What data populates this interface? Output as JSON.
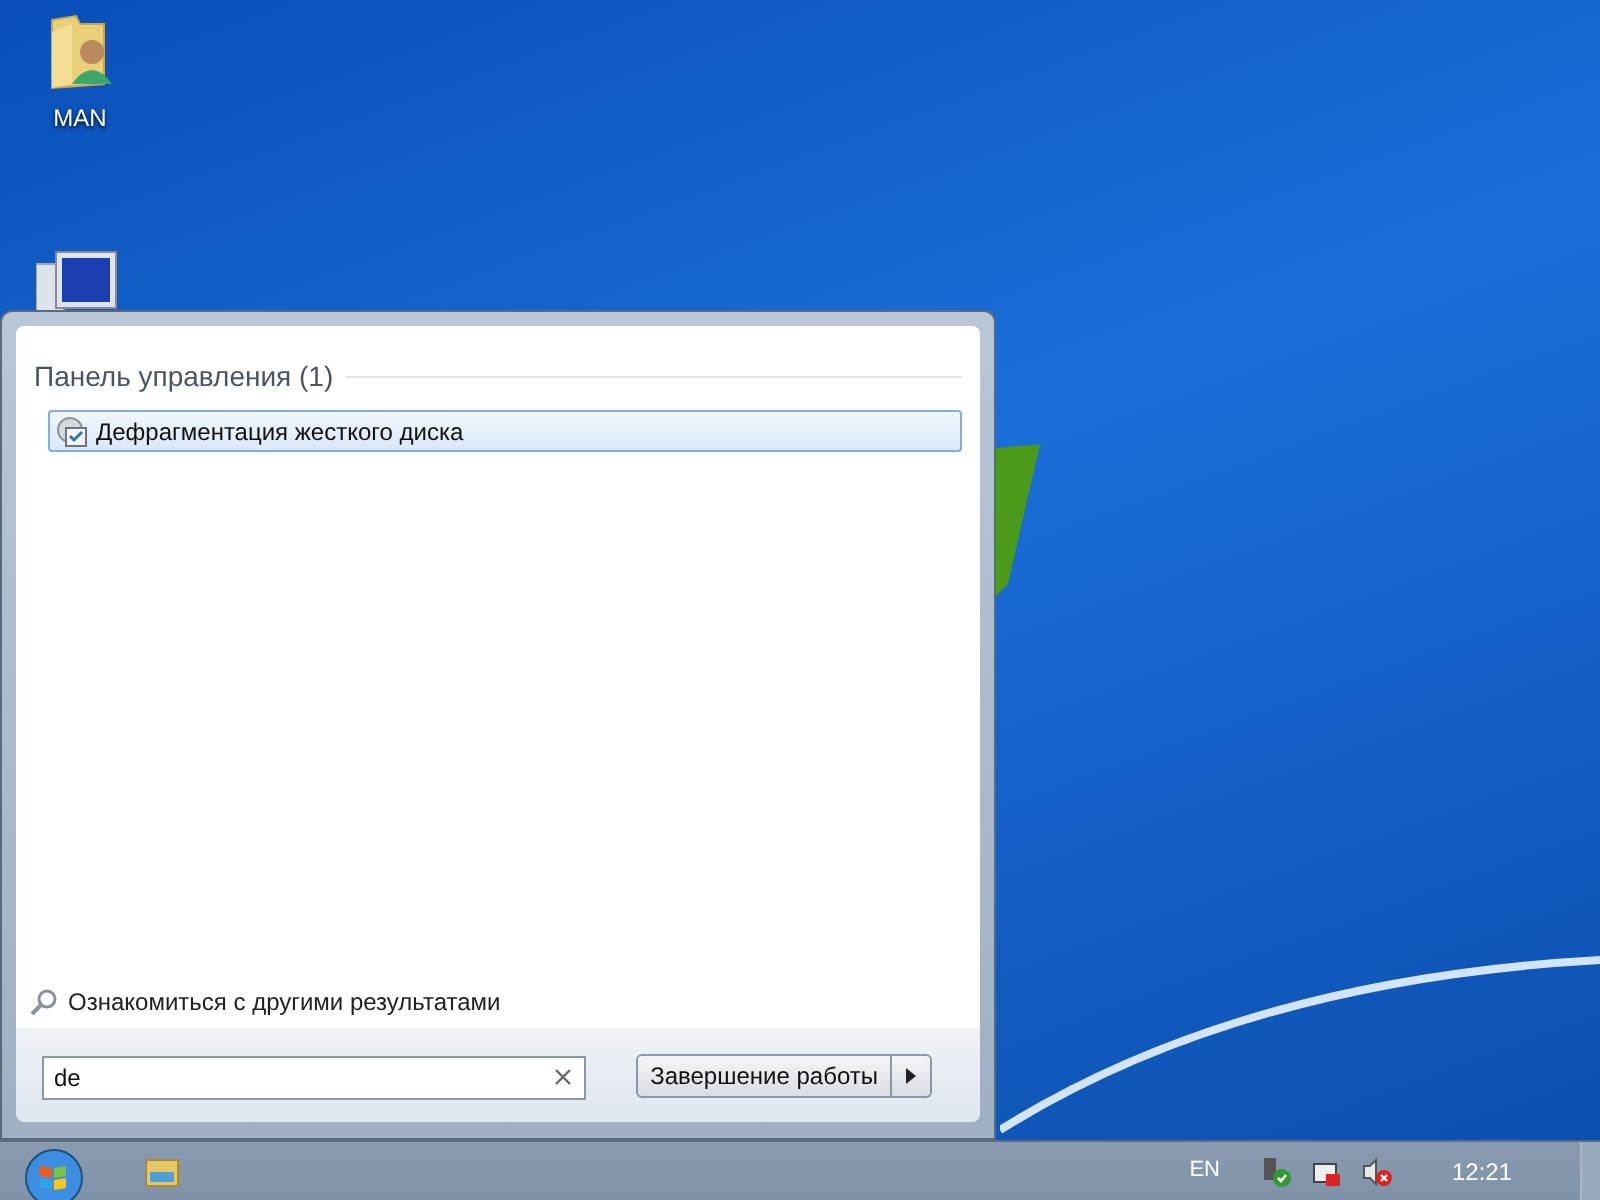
{
  "desktop_icons": [
    {
      "label": "MAN"
    }
  ],
  "start_menu": {
    "group": {
      "title": "Панель управления (1)",
      "items": [
        {
          "label": "Дефрагментация жесткого диска",
          "selected": true
        }
      ]
    },
    "more_results": "Ознакомиться с другими результатами",
    "search": {
      "value": "de"
    },
    "shutdown_button": "Завершение работы"
  },
  "taskbar": {
    "language": "EN",
    "clock": "12:21"
  }
}
